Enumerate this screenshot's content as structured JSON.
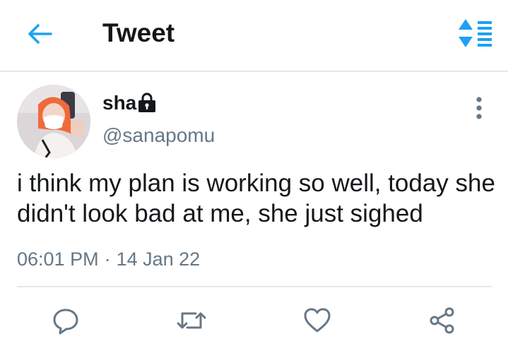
{
  "header": {
    "title": "Tweet",
    "back_icon": "arrow-left-icon",
    "sort_icon": "sort-icon",
    "accent_color": "#1da1f2"
  },
  "tweet": {
    "author": {
      "display_name": "sha",
      "handle": "@sanapomu",
      "protected_icon": "lock-icon"
    },
    "text": "i think my plan is working so well, today she didn't look bad at me, she just sighed",
    "time": "06:01 PM",
    "separator": "·",
    "date": "14 Jan 22",
    "more_icon": "more-vertical-icon"
  },
  "actions": [
    {
      "name": "reply",
      "icon": "reply-icon"
    },
    {
      "name": "retweet",
      "icon": "retweet-icon"
    },
    {
      "name": "like",
      "icon": "heart-icon"
    },
    {
      "name": "share",
      "icon": "share-icon"
    }
  ],
  "colors": {
    "text_primary": "#14171a",
    "text_secondary": "#657786",
    "divider": "#e1e8ed",
    "action_icon": "#657786"
  }
}
